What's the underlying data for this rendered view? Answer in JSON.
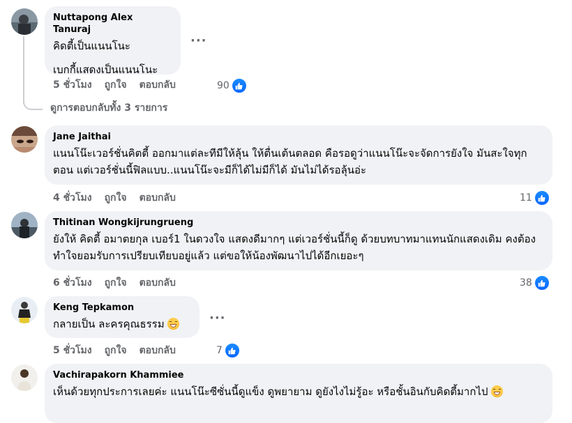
{
  "comments": [
    {
      "author": "Nuttapong Alex Tanuraj",
      "lines": [
        "คิดตี้เป็นแนนโนะ",
        "เบกกี้แสดงเป็นแนนโนะ"
      ],
      "time": "5 ชั่วโมง",
      "like_label": "ถูกใจ",
      "reply_label": "ตอบกลับ",
      "reactions": "90"
    },
    {
      "author": "Jane Jaithai",
      "text": "แนนโน๊ะเวอร์ชั่นคิตตี้ ออกมาแต่ละทีมีให้ลุ้น ให้ตื่นเต้นตลอด คือรอดูว่าแนนโน๊ะจะจัดการยังใจ มันสะใจทุกตอน แต่เวอร์ชั่นนี้ฟิลแบบ..แนนโน๊ะจะมีก็ได้ไม่มีก็ได้ มันไม่ได้รอลุ้นอ่ะ",
      "time": "4 ชั่วโมง",
      "like_label": "ถูกใจ",
      "reply_label": "ตอบกลับ",
      "reactions": "11"
    },
    {
      "author": "Thitinan Wongkijrungrueng",
      "text": "ยังให้ คิดตี้ อมาตยกุล เบอร์1 ในดวงใจ แสดงดีมากๆ แต่เวอร์ชั่นนี้ก็ดู ด้วยบทบาทมาแทนนักแสดงเดิม คงต้องทำใจยอมรับการเปรียบเทียบอยู่แล้ว แต่ขอให้น้องพัฒนาไปได้อีกเยอะๆ",
      "time": "6 ชั่วโมง",
      "like_label": "ถูกใจ",
      "reply_label": "ตอบกลับ",
      "reactions": "38"
    },
    {
      "author": "Keng Tepkamon",
      "text": "กลายเป็น ละครคุณธรรม",
      "time": "5 ชั่วโมง",
      "like_label": "ถูกใจ",
      "reply_label": "ตอบกลับ",
      "reactions": "7"
    },
    {
      "author": "Vachirapakorn Khammiee",
      "text": "เห็นด้วยทุกประการเลยค่ะ แนนโน๊ะซีซั่นนี้ดูแข็ง ดูพยายาม ดูยังไงไม่รู้อะ หรือชั้นอินกับคิดตี้มากไป"
    }
  ],
  "view_replies": "ดูการตอบกลับทั้ง 3 รายการ",
  "more_options": "···",
  "colors": {
    "bubble": "#f0f2f5",
    "meta": "#65676b",
    "like": "#0866ff"
  }
}
